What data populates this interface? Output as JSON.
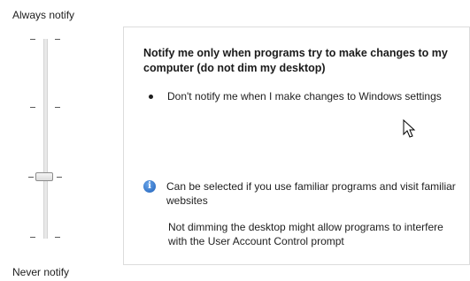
{
  "slider": {
    "top_label": "Always notify",
    "bottom_label": "Never notify",
    "level": 3,
    "levels": 4
  },
  "panel": {
    "title": "Notify me only when programs try to make changes to my computer (do not dim my desktop)",
    "bullet": "Don't notify me when I make changes to Windows settings",
    "info": "Can be selected if you use familiar programs and visit familiar websites",
    "note": "Not dimming the desktop might allow programs to interfere with the User Account Control prompt"
  },
  "icons": {
    "info": "info-icon",
    "cursor": "mouse-pointer-icon"
  },
  "colors": {
    "info_blue": "#1e5fb9",
    "border": "#dcdcdc"
  }
}
